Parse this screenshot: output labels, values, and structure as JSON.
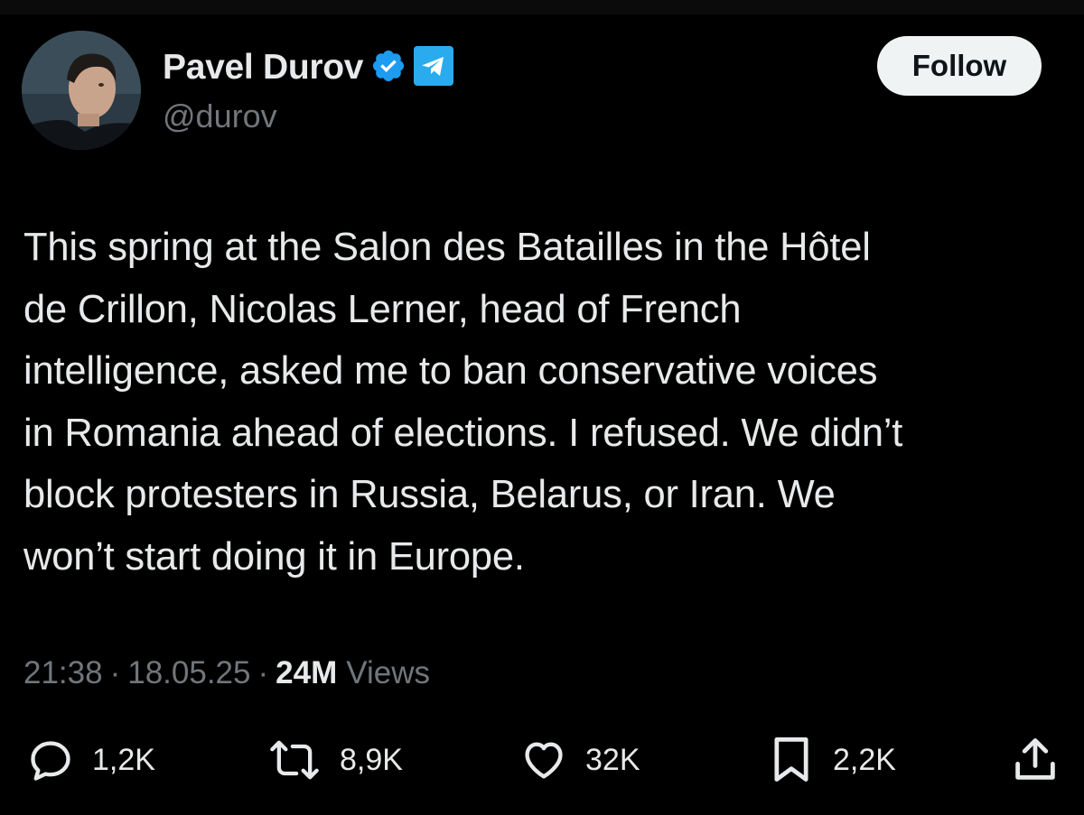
{
  "author": {
    "display_name": "Pavel Durov",
    "handle": "@durov",
    "badges": [
      "verified-badge-icon",
      "telegram-icon"
    ]
  },
  "follow_button": {
    "label": "Follow"
  },
  "tweet": {
    "text": "This spring at the Salon des Batailles in the Hôtel\nde Crillon, Nicolas Lerner, head of French\nintelligence, asked me to ban conservative voices\nin Romania ahead of elections. I refused. We didn’t\nblock protesters in Russia, Belarus, or Iran. We\nwon’t start doing it in Europe."
  },
  "meta": {
    "time": "21:38",
    "date": "18.05.25",
    "separator": "·",
    "views_count": "24M",
    "views_label": "Views"
  },
  "actions": {
    "reply": {
      "icon": "reply-icon",
      "count": "1,2K"
    },
    "repost": {
      "icon": "repost-icon",
      "count": "8,9K"
    },
    "like": {
      "icon": "heart-icon",
      "count": "32K"
    },
    "bookmark": {
      "icon": "bookmark-icon",
      "count": "2,2K"
    },
    "share": {
      "icon": "share-icon"
    }
  },
  "colors": {
    "background": "#000000",
    "text_primary": "#e7e9ea",
    "text_secondary": "#71767b",
    "verified_blue": "#1d9bf0",
    "telegram_blue": "#2aabee",
    "follow_bg": "#eff3f4"
  }
}
